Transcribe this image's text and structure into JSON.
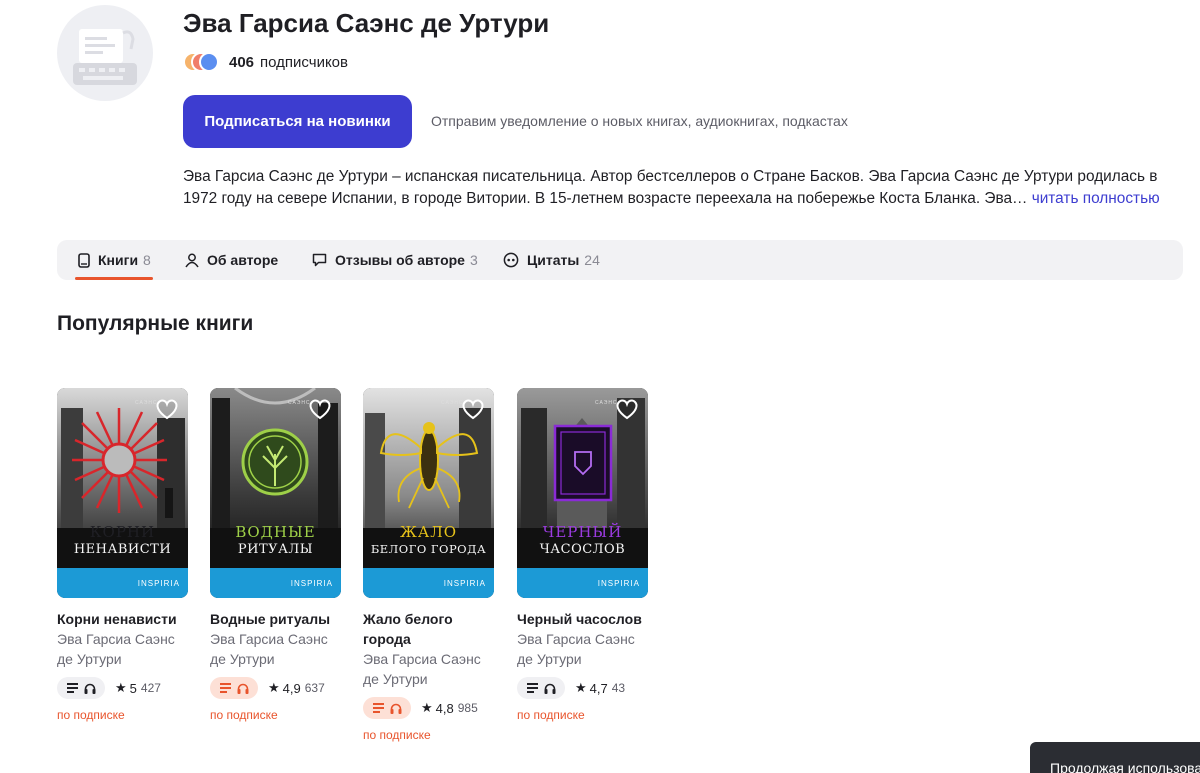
{
  "author": {
    "name": "Эва Гарсиа Саэнс де Уртури",
    "subscribers_count": "406",
    "subscribers_label": "подписчиков",
    "subscribe_button": "Подписаться на новинки",
    "subscribe_note": "Отправим уведомление о новых книгах, аудиокнигах, подкастах",
    "bio_line1": "Эва Гарсиа Саэнс де Уртури – испанская писательница. Автор бестселлеров о Стране Басков. Эва Гарсиа Саэнс де Уртури родилась в",
    "bio_line2": "1972 году на севере Испании, в городе Витории. В 15-летнем возрасте переехала на побережье Коста Бланка. Эва…",
    "read_more": "читать полностью"
  },
  "tabs": [
    {
      "label": "Книги",
      "count": "8",
      "icon": "book-icon"
    },
    {
      "label": "Об авторе",
      "count": "",
      "icon": "person-icon"
    },
    {
      "label": "Отзывы об авторе",
      "count": "3",
      "icon": "comment-icon"
    },
    {
      "label": "Цитаты",
      "count": "24",
      "icon": "quote-icon"
    }
  ],
  "section_title": "Популярные книги",
  "books": [
    {
      "title": "Корни ненависти",
      "author": "Эва Гарсиа Саэнс де Уртури",
      "cover_line1": "КОРНИ",
      "cover_line2": "НЕНАВИСТИ",
      "cover_accent": "#d8262b",
      "publisher": "INSPIRIA",
      "rating": "5",
      "rating_count": "427",
      "audio_highlight": false,
      "availability": "по подписке"
    },
    {
      "title": "Водные ритуалы",
      "author": "Эва Гарсиа Саэнс де Уртури",
      "cover_line1": "ВОДНЫЕ",
      "cover_line2": "РИТУАЛЫ",
      "cover_accent": "#9ed048",
      "publisher": "INSPIRIA",
      "rating": "4,9",
      "rating_count": "637",
      "audio_highlight": true,
      "availability": "по подписке"
    },
    {
      "title": "Жало белого города",
      "author": "Эва Гарсиа Саэнс де Уртури",
      "cover_line1": "ЖАЛО",
      "cover_line2": "БЕЛОГО ГОРОДА",
      "cover_accent": "#e6c21a",
      "publisher": "INSPIRIA",
      "rating": "4,8",
      "rating_count": "985",
      "audio_highlight": true,
      "availability": "по подписке"
    },
    {
      "title": "Черный часослов",
      "author": "Эва Гарсиа Саэнс де Уртури",
      "cover_line1": "ЧЕРНЫЙ",
      "cover_line2": "ЧАСОСЛОВ",
      "cover_accent": "#8a2bd6",
      "publisher": "INSPIRIA",
      "rating": "4,7",
      "rating_count": "43",
      "audio_highlight": false,
      "availability": "по подписке"
    }
  ],
  "cookie_banner": "Продолжая использова",
  "colors": {
    "accent_blue": "#3d3dd0",
    "accent_orange": "#e8542c",
    "strip_blue": "#1c9ad6"
  }
}
